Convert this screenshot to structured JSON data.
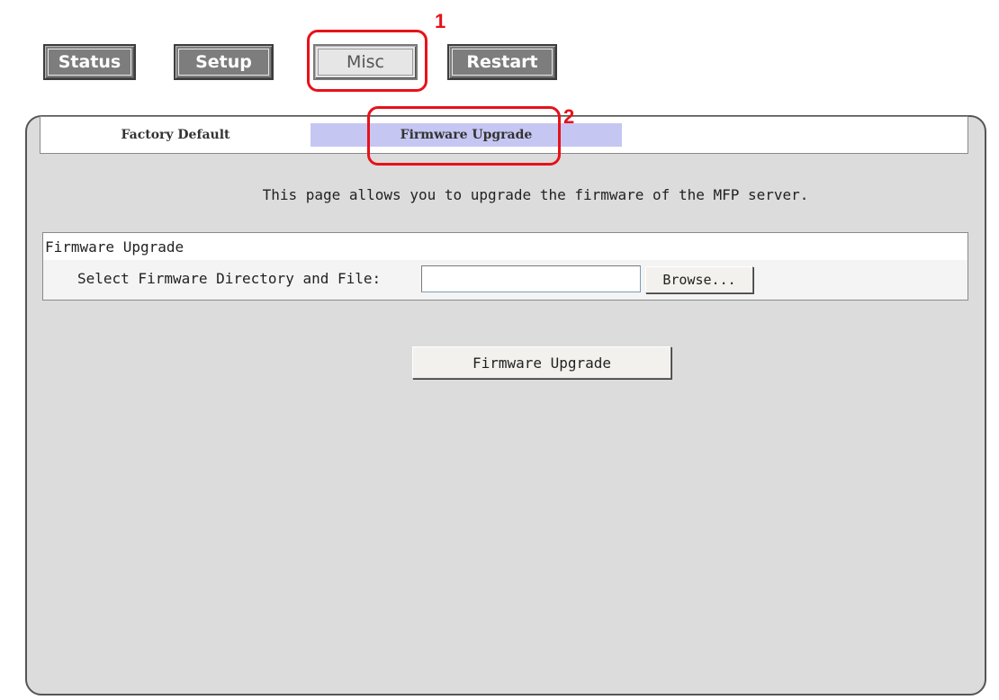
{
  "nav": {
    "status_label": "Status",
    "setup_label": "Setup",
    "misc_label": "Misc",
    "restart_label": "Restart"
  },
  "annotations": {
    "marker1": "1",
    "marker2": "2"
  },
  "subnav": {
    "factory_default_label": "Factory Default",
    "firmware_upgrade_label": "Firmware Upgrade"
  },
  "main": {
    "description": "This page allows you to upgrade the firmware of the MFP server.",
    "section_title": "Firmware Upgrade",
    "field_label": "Select Firmware Directory and File:",
    "field_value": "",
    "browse_label": "Browse...",
    "upgrade_button_label": "Firmware Upgrade"
  },
  "colors": {
    "nav_button": "#7d7d7d",
    "active_subtab": "#c6c6f2",
    "annotation": "#e8111a",
    "panel_bg": "#dcdcdc"
  }
}
